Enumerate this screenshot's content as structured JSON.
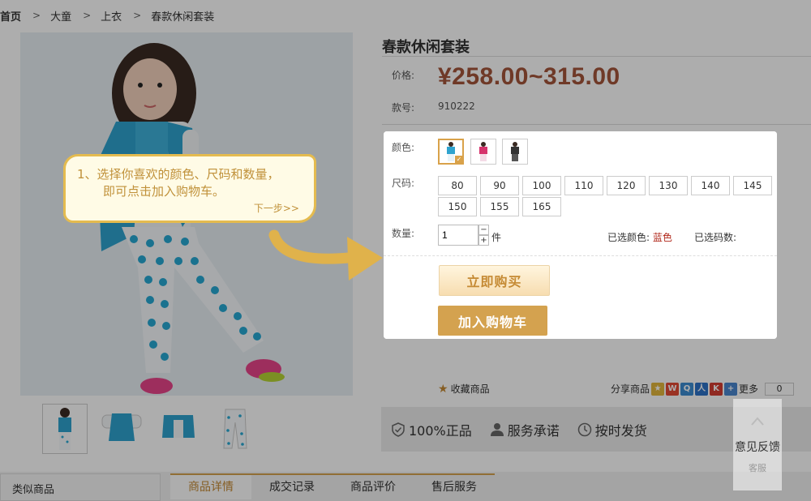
{
  "breadcrumb": {
    "items": [
      "首页",
      "大童",
      "上衣",
      "春款休闲套装"
    ],
    "separator": ">"
  },
  "product": {
    "title": "春款休闲套装",
    "price_label": "价格:",
    "price": "¥258.00~315.00",
    "sku_label": "款号:",
    "sku": "910222",
    "color_label": "颜色:",
    "size_label": "尺码:",
    "sizes": [
      "80",
      "90",
      "100",
      "110",
      "120",
      "130",
      "140",
      "145",
      "150",
      "155",
      "165"
    ],
    "qty_label": "数量:",
    "qty_value": "1",
    "qty_unit": "件",
    "selected_color_label": "已选颜色:",
    "selected_color": "蓝色",
    "selected_count_label": "已选码数:",
    "buy_now": "立即购买",
    "add_to_cart": "加入购物车",
    "favorite": "收藏商品",
    "share_label": "分享商品",
    "more": "更多",
    "share_count": "0"
  },
  "guarantees": [
    "100%正品",
    "服务承诺",
    "按时发货"
  ],
  "guide": {
    "text_line1": "1、选择你喜欢的颜色、尺码和数量，",
    "text_line2": "即可点击加入购物车。",
    "next": "下一步>>"
  },
  "tabs": {
    "similar": "类似商品",
    "items": [
      "商品详情",
      "成交记录",
      "商品评价",
      "售后服务"
    ]
  },
  "feedback": {
    "label": "意见反馈",
    "service": "客服"
  },
  "colors": {
    "accent": "#d4a24f",
    "price": "#a4553a",
    "selected_color_text": "#b0271a"
  }
}
